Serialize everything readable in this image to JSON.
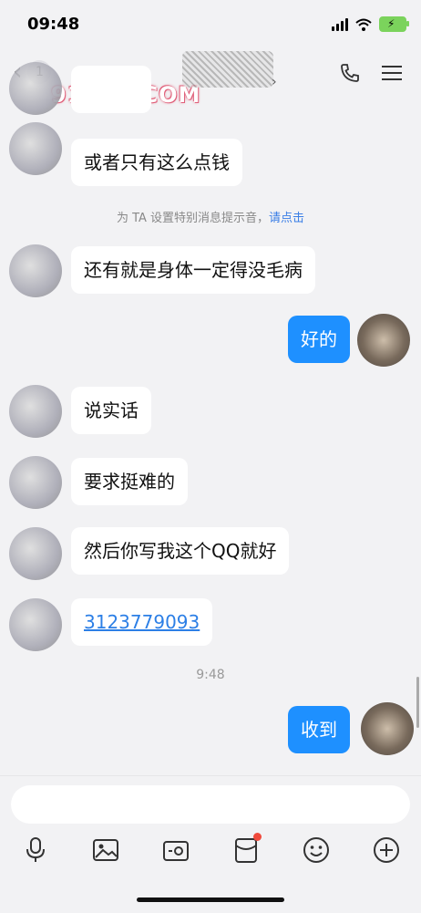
{
  "status": {
    "time": "09:48"
  },
  "nav": {
    "unread_count": "1",
    "watermark": "91P46.COM"
  },
  "messages": [
    {
      "side": "left",
      "text": "或者只有这么点钱"
    },
    {
      "side": "left",
      "text": "还有就是身体一定得没毛病"
    },
    {
      "side": "right",
      "text": "好的"
    },
    {
      "side": "left",
      "text": "说实话"
    },
    {
      "side": "left",
      "text": "要求挺难的"
    },
    {
      "side": "left",
      "text": "然后你写我这个QQ就好"
    },
    {
      "side": "left",
      "text": "3123779093"
    },
    {
      "side": "right",
      "text": "收到"
    }
  ],
  "system_tip": {
    "text": "为 TA 设置特别消息提示音，",
    "action": "请点击"
  },
  "timestamp": "9:48",
  "toolbar": [
    "microphone-icon",
    "image-icon",
    "camera-icon",
    "red-packet-icon",
    "emoji-icon",
    "add-icon"
  ],
  "colors": {
    "bubble_blue": "#1e90ff",
    "link": "#2c7fe6",
    "badge_dot": "#f04a3c",
    "battery": "#7bd35c"
  }
}
